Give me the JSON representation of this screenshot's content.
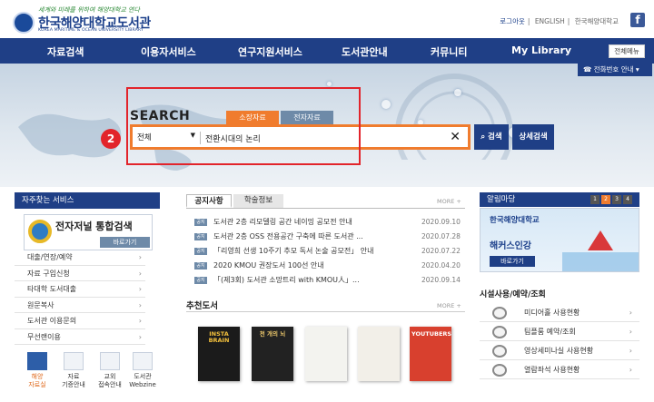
{
  "header": {
    "slogan": "세계와 미래를 위하여 해양대학교 연다",
    "library_name": "한국해양대학교도서관",
    "library_name_eng": "KOREA MARITIME & OCEAN UNIVERSITY LIBRARY",
    "util": {
      "logout": "로그아웃",
      "english": "ENGLISH",
      "university": "한국해양대학교"
    },
    "facebook": "f"
  },
  "nav": {
    "items": [
      "자료검색",
      "이용자서비스",
      "연구지원서비스",
      "도서관안내",
      "커뮤니티",
      "My Library"
    ],
    "all_menu": "전체메뉴"
  },
  "hero": {
    "phone_button": "전화번호 안내"
  },
  "search": {
    "title": "SEARCH",
    "tabs": [
      "소장자료",
      "전자자료"
    ],
    "scope": "전체",
    "query": "전환시대의 논리",
    "search_button": "검색",
    "advanced_button": "상세검색",
    "step_number": "2"
  },
  "sidebar": {
    "title": "자주찾는 서비스",
    "banner_title": "전자저널 통합검색",
    "banner_button": "바로가기",
    "items": [
      "대출/연장/예약",
      "자료 구입신청",
      "타대학 도서대출",
      "원문복사",
      "도서관 이용문의",
      "무선랜이용"
    ],
    "quick": [
      {
        "label": "해양\n자료실",
        "active": true
      },
      {
        "label": "자료\n기증안내",
        "active": false
      },
      {
        "label": "교외\n접속안내",
        "active": false
      },
      {
        "label": "도서관\nWebzine",
        "active": false
      }
    ]
  },
  "notices": {
    "tabs": [
      "공지사항",
      "학술정보"
    ],
    "more": "MORE +",
    "tag": "공지",
    "items": [
      {
        "title": "도서관 2층 리모델링 공간 네이밍 공모전 안내",
        "date": "2020.09.10"
      },
      {
        "title": "도서관 2층 OSS 전용공간 구축에 따른 도서관 ...",
        "date": "2020.07.28"
      },
      {
        "title": "「리영희 선생 10주기 추모 독서 논술 공모전」 안내",
        "date": "2020.07.22"
      },
      {
        "title": "2020 KMOU 권장도서 100선 안내",
        "date": "2020.04.20"
      },
      {
        "title": "「(제3회) 도서관 소망트리 with KMOU人」...",
        "date": "2020.09.14"
      }
    ]
  },
  "recommended": {
    "title": "추천도서",
    "more": "MORE +",
    "books": [
      {
        "title": "INSTA BRAIN",
        "bg": "#1b1b1b",
        "fg": "#f3c03c"
      },
      {
        "title": "천 개의 뇌",
        "bg": "#222222",
        "fg": "#e9c56a"
      },
      {
        "title": "",
        "bg": "#f3f3ef",
        "fg": "#2a6c3a"
      },
      {
        "title": "",
        "bg": "#f2efe8",
        "fg": "#c43d2f"
      },
      {
        "title": "YOUTUBERS",
        "bg": "#d8402e",
        "fg": "#ffffff"
      }
    ]
  },
  "alarm": {
    "title": "알림마당",
    "pager": [
      "1",
      "2",
      "3",
      "4"
    ],
    "banner_library": "한국해양대학교",
    "banner_promo": "해커스인강",
    "banner_button": "바로가기"
  },
  "facilities": {
    "title": "시설사용/예약/조회",
    "items": [
      "미디어홀 사용현황",
      "팀플룸 예약/조회",
      "영상세미나실 사용현황",
      "열람좌석 사용현황"
    ]
  },
  "colors": {
    "navy": "#1f3f86",
    "orange": "#f07c2e",
    "highlight_red": "#e2242b"
  }
}
